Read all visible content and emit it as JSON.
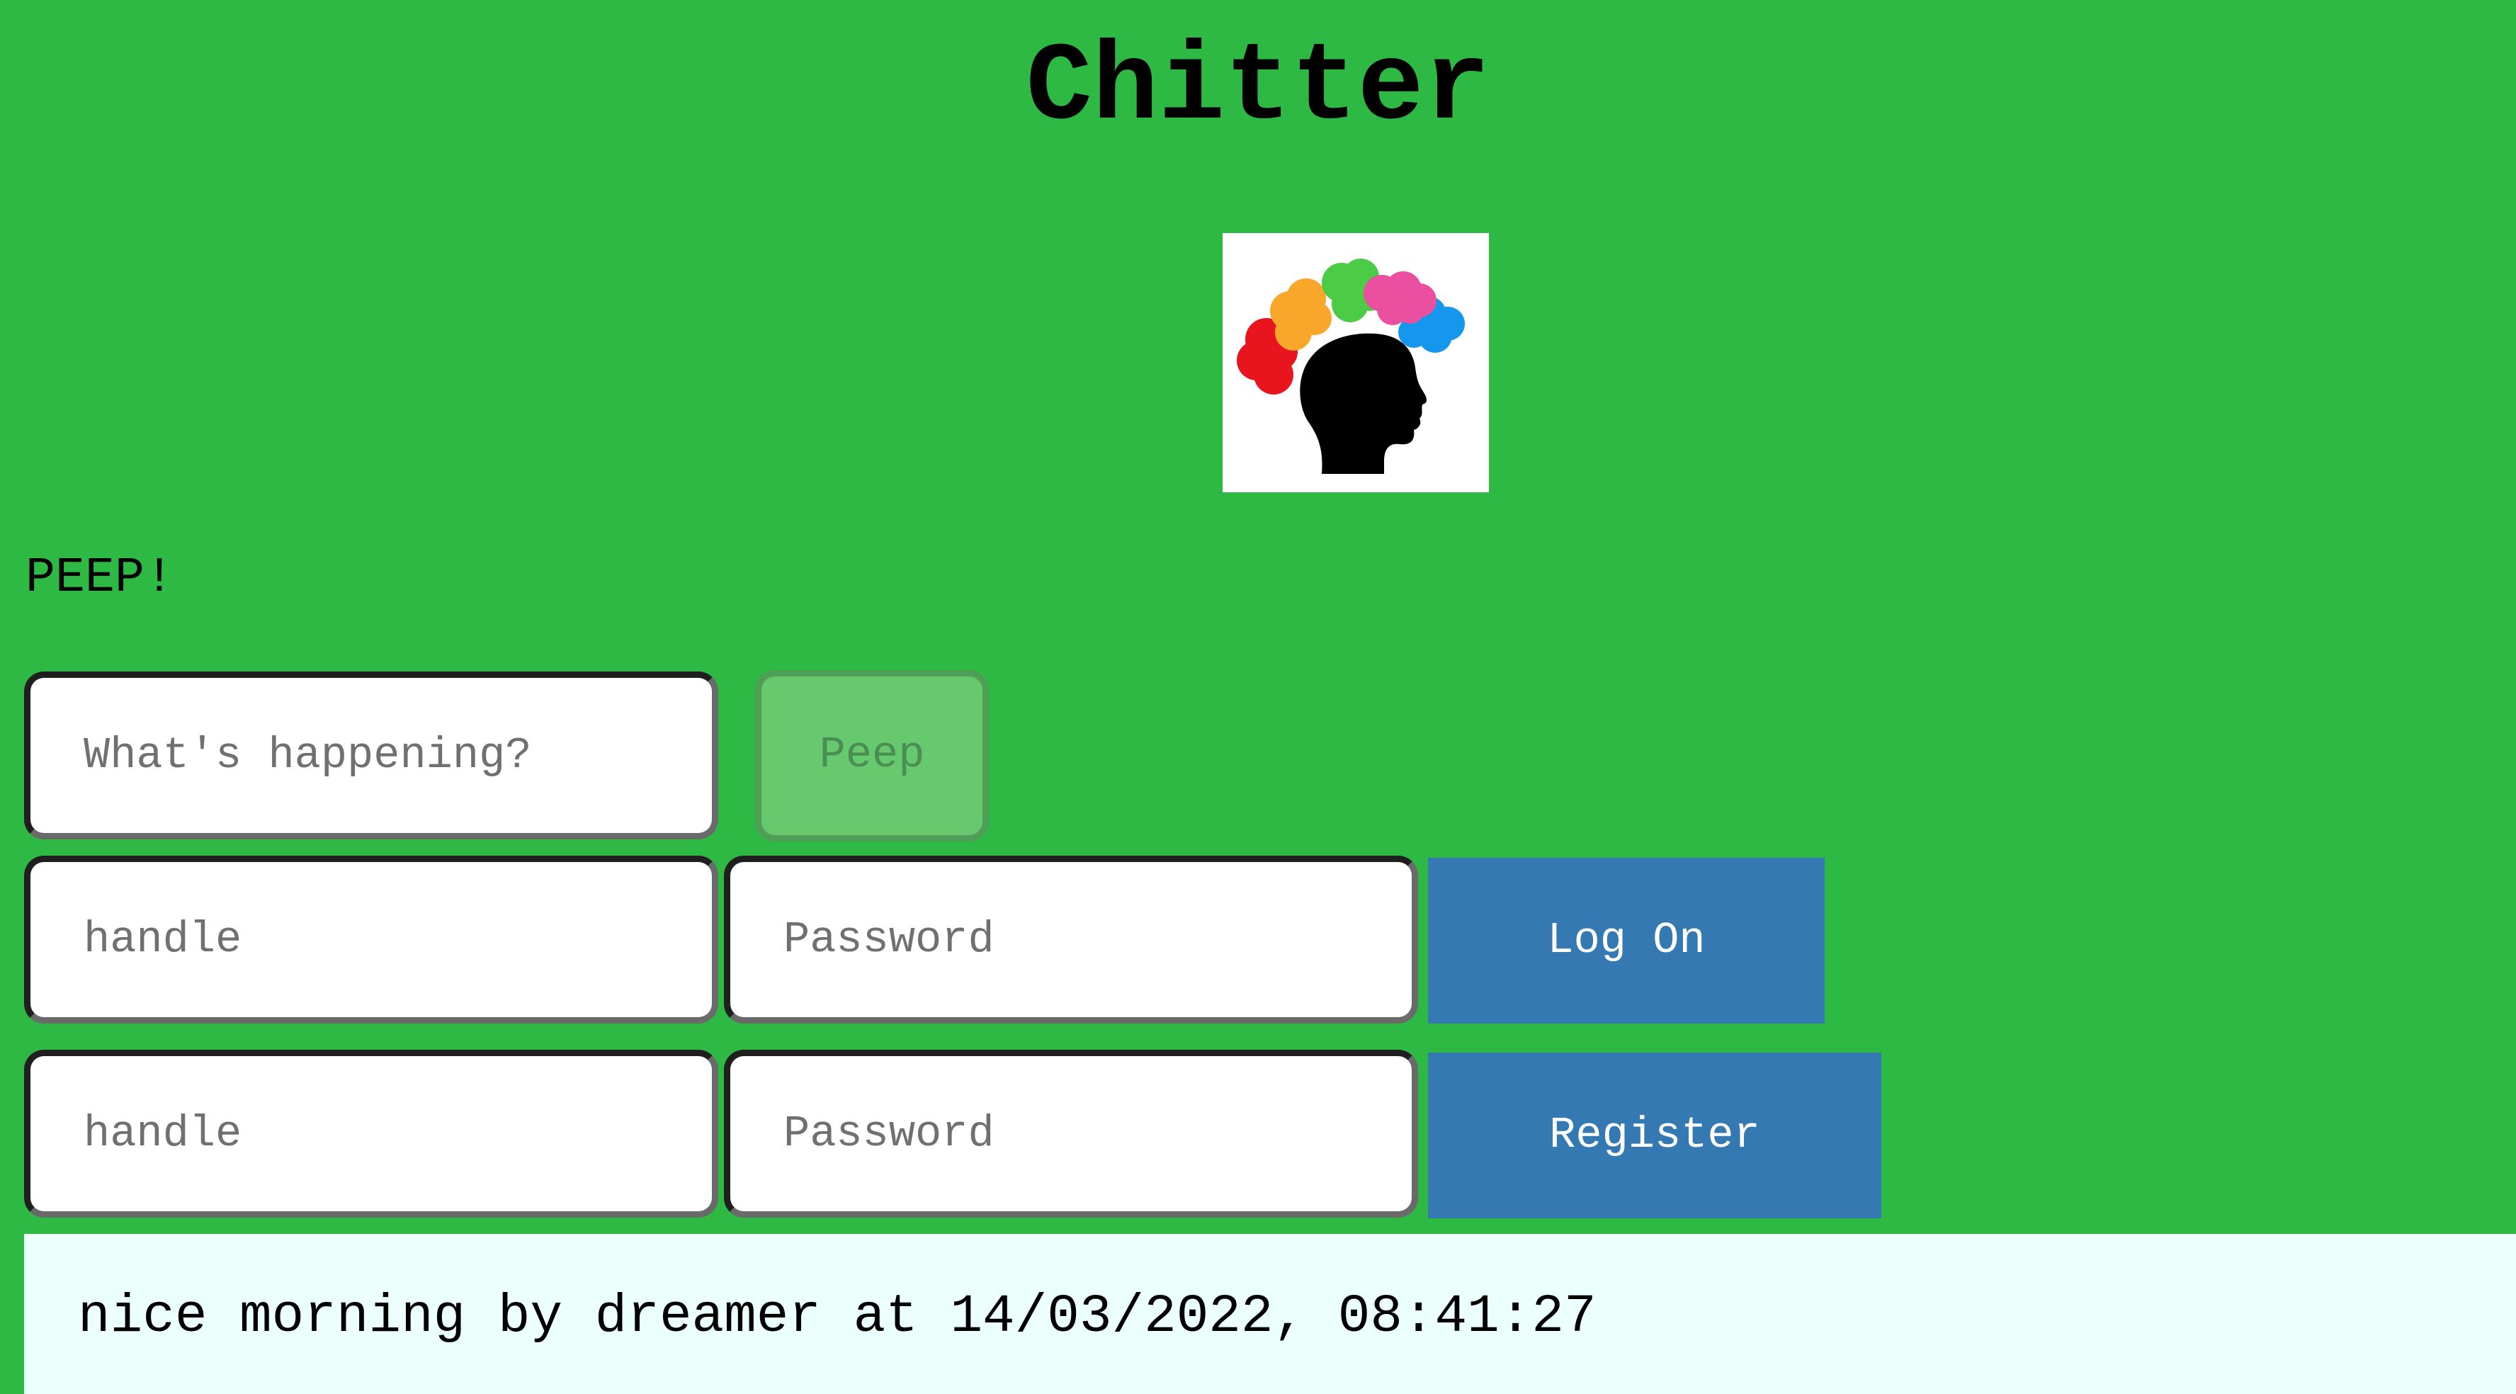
{
  "header": {
    "title": "Chitter"
  },
  "compose": {
    "label": "PEEP!",
    "input_placeholder": "What's happening?",
    "submit_label": "Peep"
  },
  "login": {
    "handle_placeholder": "handle",
    "password_placeholder": "Password",
    "submit_label": "Log On"
  },
  "register": {
    "handle_placeholder": "handle",
    "password_placeholder": "Password",
    "submit_label": "Register"
  },
  "feed": {
    "peeps": [
      {
        "text": "nice morning",
        "author": "dreamer",
        "timestamp": "14/03/2022, 08:41:27"
      }
    ]
  },
  "colors": {
    "background": "#2eb944",
    "button": "#3479b1",
    "peep_button_disabled": "#66c96e",
    "feed_background": "#ebfffd"
  },
  "icons": {
    "logo": "head-with-colorful-brains-icon"
  }
}
